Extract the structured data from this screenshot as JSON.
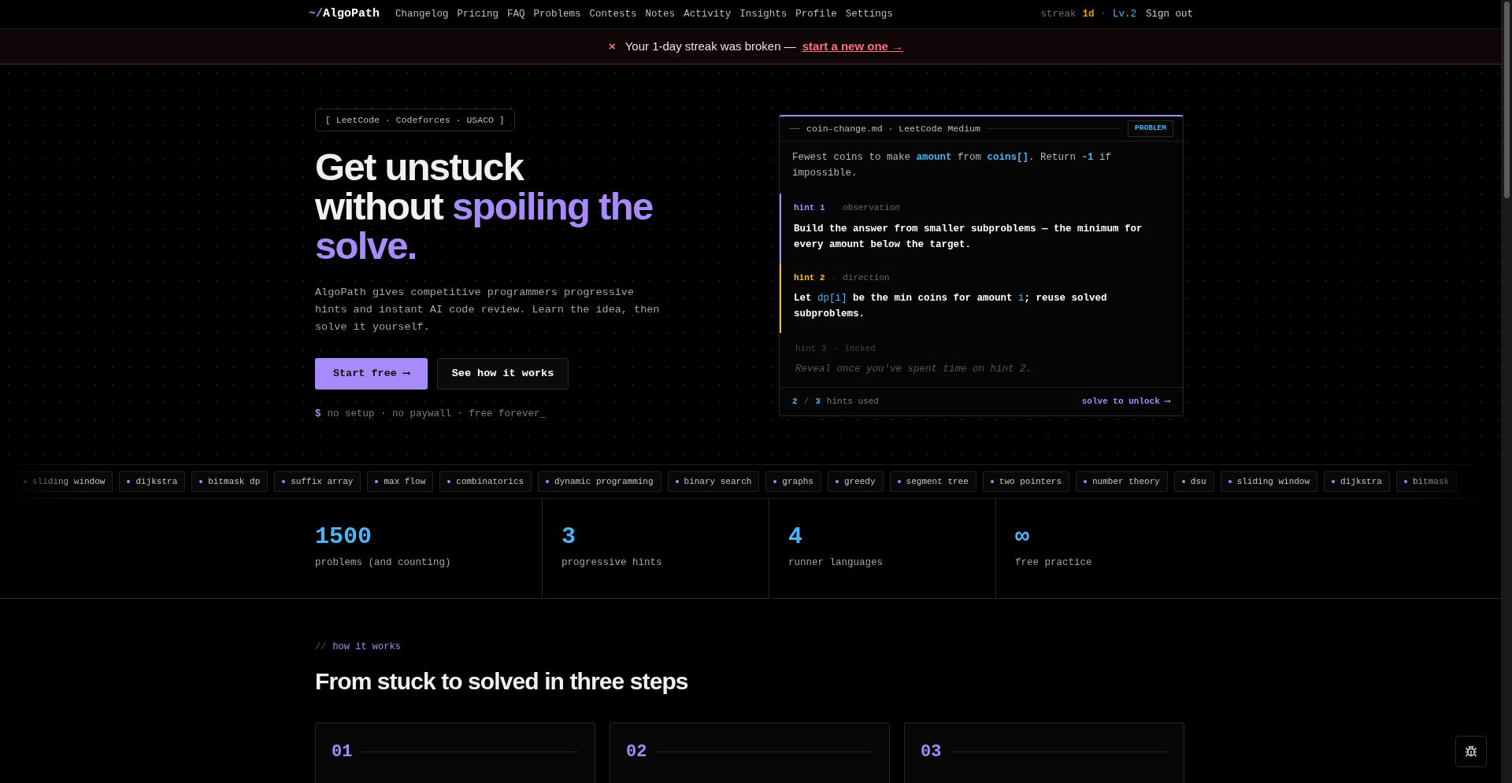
{
  "nav": {
    "logo_prefix": "~/",
    "logo": "AlgoPath",
    "links": [
      {
        "label": "Changelog"
      },
      {
        "label": "Pricing"
      },
      {
        "label": "FAQ"
      },
      {
        "label": "Problems"
      },
      {
        "label": "Contests"
      },
      {
        "label": "Notes"
      },
      {
        "label": "Activity"
      },
      {
        "label": "Insights"
      },
      {
        "label": "Profile"
      },
      {
        "label": "Settings"
      }
    ],
    "streak_label": "streak",
    "streak_value": "1d",
    "separator": "·",
    "level": "Lv.2",
    "sign_out": "Sign out"
  },
  "banner": {
    "icon": "×",
    "message": "Your 1-day streak was broken —",
    "link": "start a new one →"
  },
  "hero": {
    "sources": "[ LeetCode · Codeforces · USACO ]",
    "heading": [
      [
        {
          "text": "Get unstuck",
          "accent": false
        }
      ],
      [
        {
          "text": "without ",
          "accent": false
        },
        {
          "text": "spoiling the",
          "accent": true
        }
      ],
      [
        {
          "text": "solve.",
          "accent": true
        }
      ]
    ],
    "description": "AlgoPath gives competitive programmers progressive hints and instant AI code review. Learn the idea, then solve it yourself.",
    "primary_button": "Start free ⟶",
    "secondary_button": "See how it works",
    "prompt": "$",
    "footnote": "no setup · no paywall · free forever_"
  },
  "problem_card": {
    "file": "coin-change.md · LeetCode Medium",
    "badge": "PROBLEM",
    "statement": [
      {
        "text": "Fewest coins to make ",
        "kind": "plain"
      },
      {
        "text": "amount",
        "kind": "code"
      },
      {
        "text": " from ",
        "kind": "plain"
      },
      {
        "text": "coins[]",
        "kind": "code"
      },
      {
        "text": ". Return ",
        "kind": "plain"
      },
      {
        "text": "-1",
        "kind": "code"
      },
      {
        "text": " if impossible.",
        "kind": "plain"
      }
    ],
    "hints": [
      {
        "kind": "revealed",
        "title": "hint 1",
        "separator": "·",
        "tag": "observation",
        "color": "#a78bfa",
        "body": [
          {
            "text": "Build the answer from smaller subproblems — the minimum for every amount below the target.",
            "kind": "plain"
          }
        ]
      },
      {
        "kind": "revealed",
        "title": "hint 2",
        "separator": "·",
        "tag": "direction",
        "color": "#fbbf24",
        "body": [
          {
            "text": "Let ",
            "kind": "plain"
          },
          {
            "text": "dp[i]",
            "kind": "code"
          },
          {
            "text": " be the min coins for amount ",
            "kind": "plain"
          },
          {
            "text": "i",
            "kind": "code"
          },
          {
            "text": "; reuse solved subproblems.",
            "kind": "plain"
          }
        ]
      },
      {
        "kind": "locked",
        "title": "hint 3",
        "separator": "·",
        "tag": "locked",
        "body": [
          {
            "text": "Reveal once you've spent time on hint 2.",
            "kind": "plain"
          }
        ]
      }
    ],
    "used": "2",
    "slash": "/",
    "total": "3",
    "used_label": "hints used",
    "unlock": "solve to unlock ⟶"
  },
  "topics": [
    {
      "label": "sliding window"
    },
    {
      "label": "dijkstra"
    },
    {
      "label": "bitmask dp"
    },
    {
      "label": "suffix array"
    },
    {
      "label": "max flow"
    },
    {
      "label": "combinatorics"
    },
    {
      "label": "dynamic programming"
    },
    {
      "label": "binary search"
    },
    {
      "label": "graphs"
    },
    {
      "label": "greedy"
    },
    {
      "label": "segment tree"
    },
    {
      "label": "two pointers"
    },
    {
      "label": "number theory"
    },
    {
      "label": "dsu"
    },
    {
      "label": "sliding window"
    },
    {
      "label": "dijkstra"
    },
    {
      "label": "bitmask"
    }
  ],
  "stats": [
    {
      "value": "1500",
      "label": "problems (and counting)"
    },
    {
      "value": "3",
      "label": "progressive hints"
    },
    {
      "value": "4",
      "label": "runner languages"
    },
    {
      "value": "∞",
      "label": "free practice"
    }
  ],
  "how": {
    "kicker_prefix": "//",
    "kicker": "how it works",
    "heading": "From stuck to solved in three steps",
    "steps": [
      {
        "number": "01"
      },
      {
        "number": "02"
      },
      {
        "number": "03"
      }
    ]
  }
}
